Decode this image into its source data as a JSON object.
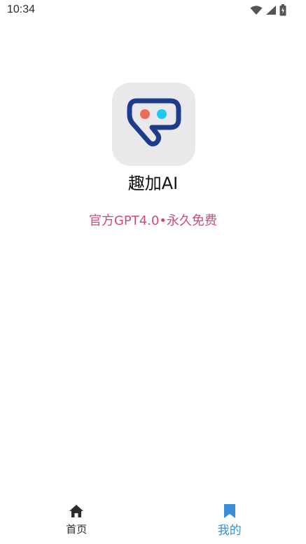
{
  "status_bar": {
    "time": "10:34",
    "icons": [
      "wifi-icon",
      "signal-icon",
      "battery-icon"
    ]
  },
  "app": {
    "name": "趣加AI",
    "slogan": "官方GPT4.0•永久免费",
    "logo_icon": "chat-bubble-logo-icon",
    "colors": {
      "slogan": "#d04a78",
      "logo_bg": "#e9e9eb",
      "logo_outline": "#1e3c8c",
      "logo_dot_left": "#f06a5a",
      "logo_dot_right": "#1ec8f0"
    }
  },
  "bottom_nav": {
    "items": [
      {
        "label": "首页",
        "icon": "home-icon",
        "active": false
      },
      {
        "label": "我的",
        "icon": "bookmark-icon",
        "active": true
      }
    ],
    "active_color": "#3a8fd8"
  }
}
